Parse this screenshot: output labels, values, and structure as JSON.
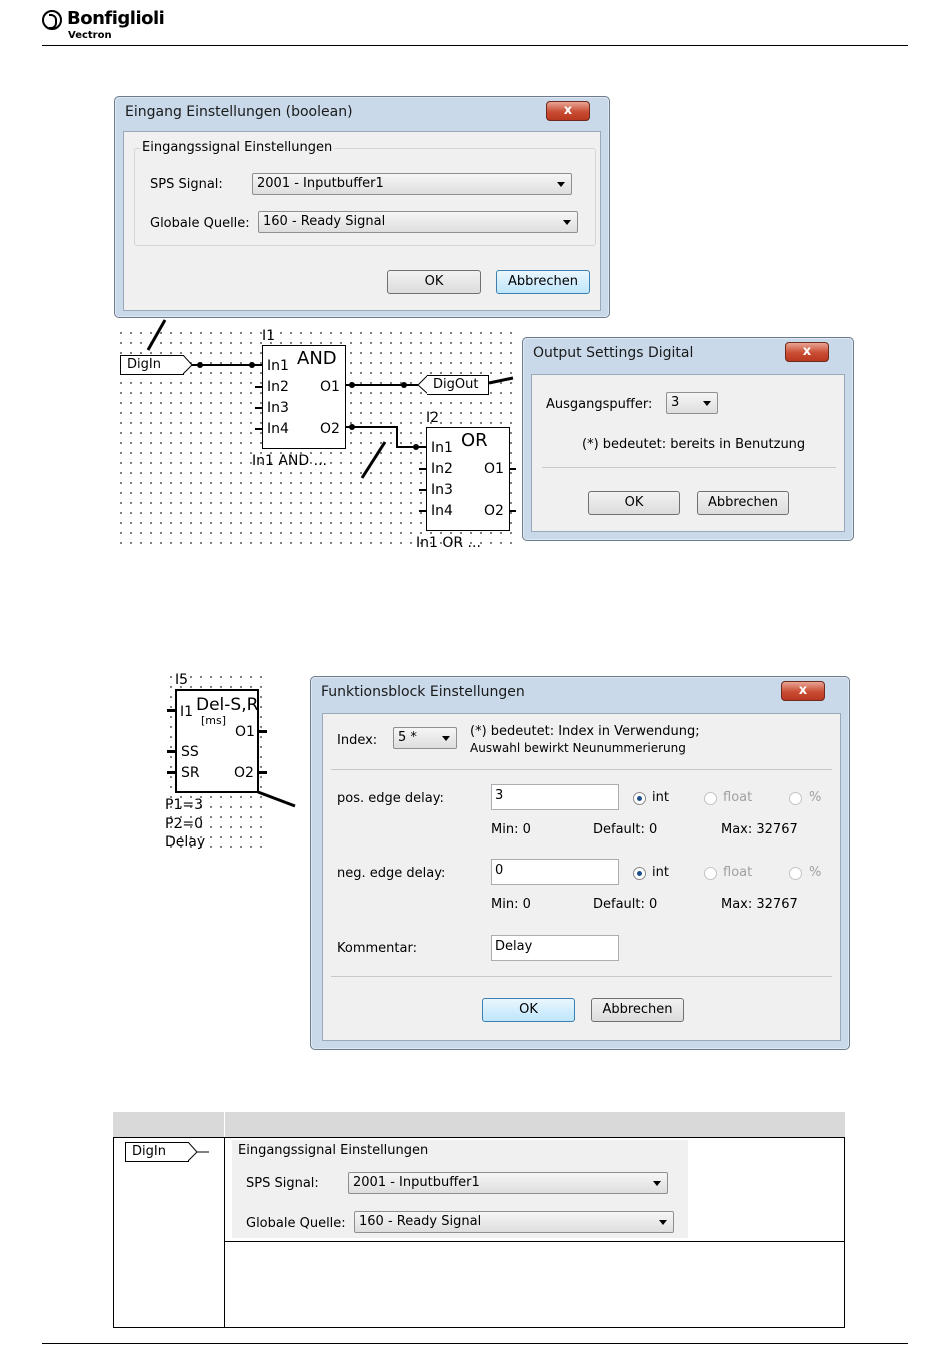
{
  "header": {
    "brand": "Bonfiglioli",
    "sub_brand": "Vectron"
  },
  "dialog_input": {
    "title": "Eingang Einstellungen (boolean)",
    "close_label": "x",
    "group_title": "Eingangssignal Einstellungen",
    "sps_label": "SPS Signal:",
    "sps_value": "2001 - Inputbuffer1",
    "global_label": "Globale Quelle:",
    "global_value": "160 - Ready Signal",
    "ok_label": "OK",
    "cancel_label": "Abbrechen"
  },
  "diagram1": {
    "digin_label": "DigIn",
    "digout_label": "DigOut",
    "and_block": {
      "id": "I1",
      "name": "AND",
      "inputs": [
        "In1",
        "In2",
        "In3",
        "In4"
      ],
      "outputs": [
        "O1",
        "O2"
      ],
      "caption": "In1 AND ..."
    },
    "or_block": {
      "id": "I2",
      "name": "OR",
      "inputs": [
        "In1",
        "In2",
        "In3",
        "In4"
      ],
      "outputs": [
        "O1",
        "O2"
      ],
      "caption": "In1 OR ..."
    }
  },
  "dialog_output": {
    "title": "Output Settings Digital",
    "close_label": "x",
    "buffer_label": "Ausgangspuffer:",
    "buffer_value": "3",
    "note": "(*) bedeutet: bereits in Benutzung",
    "ok_label": "OK",
    "cancel_label": "Abbrechen"
  },
  "diagram2": {
    "block": {
      "id": "I5",
      "name": "Del-S,R",
      "unit": "[ms]",
      "input1": "I1",
      "out1": "O1",
      "in_ss": "SS",
      "in_sr": "SR",
      "out2": "O2"
    },
    "params": [
      "P1=3",
      "P2=0",
      "Delay"
    ]
  },
  "dialog_function": {
    "title": "Funktionsblock Einstellungen",
    "close_label": "x",
    "index_label": "Index:",
    "index_value": "5 *",
    "index_note_1": "(*) bedeutet: Index in Verwendung;",
    "index_note_2": "Auswahl bewirkt Neunummerierung",
    "pos_label": "pos. edge delay:",
    "pos_value": "3",
    "neg_label": "neg. edge delay:",
    "neg_value": "0",
    "opt_int": "int",
    "opt_float": "float",
    "opt_pct": "%",
    "min_label": "Min: 0",
    "default_label": "Default: 0",
    "max_label": "Max: 32767",
    "comment_label": "Kommentar:",
    "comment_value": "Delay",
    "ok_label": "OK",
    "cancel_label": "Abbrechen"
  },
  "table": {
    "row_symbol": "DigIn",
    "group_title": "Eingangssignal Einstellungen",
    "sps_label": "SPS Signal:",
    "sps_value": "2001 - Inputbuffer1",
    "global_label": "Globale Quelle:",
    "global_value": "160 - Ready Signal"
  }
}
